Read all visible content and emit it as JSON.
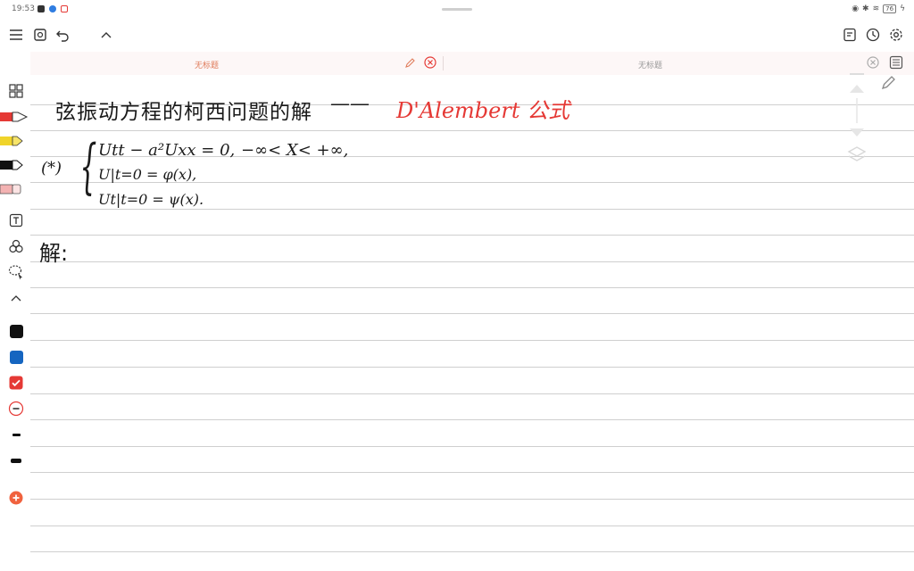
{
  "status": {
    "time": "19:53",
    "battery": "76"
  },
  "tabs": [
    {
      "title": "无标题",
      "active": true
    },
    {
      "title": "无标题",
      "active": false
    }
  ],
  "note": {
    "title_cn": "弦振动方程的柯西问题的解",
    "dash": "——",
    "title_formula": "D'Alembert 公式",
    "system_label": "(*)",
    "brace": "{",
    "eq1": "Utt − a²Uxx = 0,",
    "eq1_domain": "−∞< X< +∞,",
    "eq2": "U|t=0 = φ(x),",
    "eq3": "Ut|t=0 = ψ(x).",
    "solution_label": "解:"
  },
  "colors": {
    "accent": "#e53935",
    "ink": "#1a1a1a",
    "formula_red": "#e53935",
    "blue": "#1565c0",
    "rule": "#cfcfcf"
  },
  "icons": {
    "menu": "menu-icon",
    "export": "export-icon",
    "undo": "undo-icon",
    "collapse": "chevron-up-icon",
    "notes": "notes-icon",
    "clock": "clock-icon",
    "settings": "gear-icon"
  }
}
